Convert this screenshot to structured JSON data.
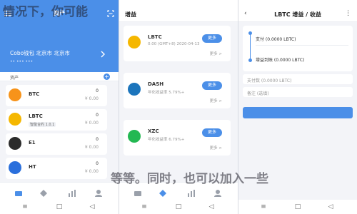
{
  "panel1": {
    "header": {
      "title": "资产"
    },
    "wallet": {
      "name": "Cobo钱包 北京市 北京市",
      "scan_hint": "•• ••• •••"
    },
    "assets_bar": {
      "label": "资产"
    },
    "assets": [
      {
        "symbol": "BTC",
        "badge": "",
        "amount": "0",
        "fiat": "¥ 0.00",
        "color": "#f7931a"
      },
      {
        "symbol": "LBTC",
        "badge": "智能合约 1.0.1",
        "amount": "0",
        "fiat": "¥ 0.00",
        "color": "#f5b700"
      },
      {
        "symbol": "E1",
        "badge": "",
        "amount": "0",
        "fiat": "¥ 0.00",
        "color": "#2b2b2b"
      },
      {
        "symbol": "HT",
        "badge": "",
        "amount": "0",
        "fiat": "¥ 0.00",
        "color": "#2a6fdc"
      }
    ],
    "overlay_top": "情况下，你可能",
    "overlay_bottom": "等等。同时，也可以加入一些"
  },
  "panel2": {
    "header": {
      "title": "增益"
    },
    "tokens": [
      {
        "symbol": "LBTC",
        "desc": "0.00 (GMT+8) 2020-04-13",
        "button": "更多",
        "more": "更多 >",
        "color": "#f5b700"
      },
      {
        "symbol": "DASH",
        "desc": "年化收益率 5.79%+",
        "button": "更多",
        "more": "更多 >",
        "color": "#1c75bc"
      },
      {
        "symbol": "XZC",
        "desc": "年化收益率 6.79%+",
        "button": "更多",
        "more": "更多 >",
        "color": "#23b852"
      }
    ]
  },
  "panel3": {
    "header": {
      "title": "LBTC 增益 / 收益",
      "back": "‹",
      "more": "⋮"
    },
    "form": {
      "from_label": "支付 (0.0000 LBTC)",
      "to_label": "增益到账 (0.0000 LBTC)",
      "pay_label": "支付数 (0.0000 LBTC)",
      "note_label": "备注 (选填)"
    }
  },
  "colors": {
    "accent": "#4b8fe8"
  }
}
